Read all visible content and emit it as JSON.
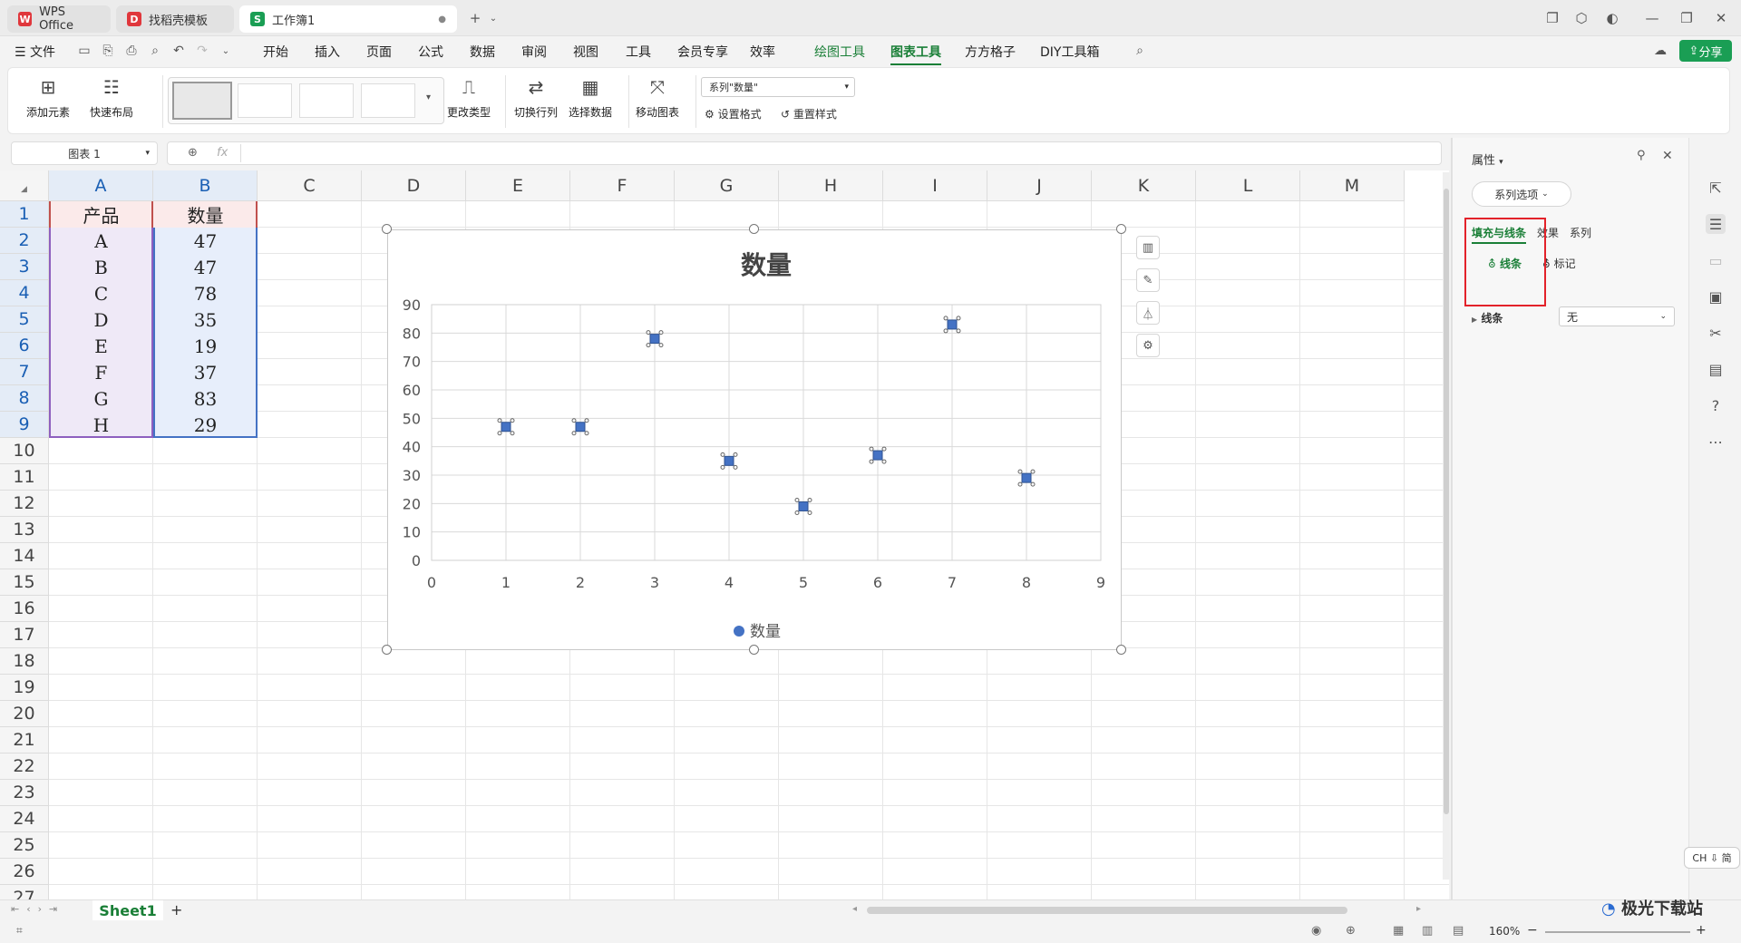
{
  "tabs": [
    {
      "label": "WPS Office",
      "icon": "wps-logo-icon"
    },
    {
      "label": "找稻壳模板",
      "icon": "docer-icon"
    },
    {
      "label": "工作簿1",
      "icon": "spreadsheet-icon"
    }
  ],
  "menu": {
    "file": "文件",
    "items": [
      "开始",
      "插入",
      "页面",
      "公式",
      "数据",
      "审阅",
      "视图",
      "工具",
      "会员专享",
      "效率",
      "绘图工具",
      "图表工具",
      "方方格子",
      "DIY工具箱"
    ],
    "active": "图表工具",
    "share": "分享"
  },
  "ribbon": {
    "add_element": "添加元素",
    "quick_layout": "快速布局",
    "change_type": "更改类型",
    "switch_rowcol": "切换行列",
    "select_data": "选择数据",
    "move_chart": "移动图表",
    "series_select": "系列\"数量\"",
    "set_format": "设置格式",
    "reset_style": "重置样式"
  },
  "formula": {
    "name_box": "图表 1",
    "fx": "fx"
  },
  "sheet": {
    "columns": [
      "A",
      "B",
      "C",
      "D",
      "E",
      "F",
      "G",
      "H",
      "I",
      "J",
      "K",
      "L",
      "M"
    ],
    "rows": [
      "1",
      "2",
      "3",
      "4",
      "5",
      "6",
      "7",
      "8",
      "9",
      "10",
      "11",
      "12",
      "13",
      "14",
      "15",
      "16",
      "17",
      "18",
      "19",
      "20",
      "21",
      "22",
      "23",
      "24",
      "25",
      "26",
      "27"
    ],
    "headers": [
      "产品",
      "数量"
    ],
    "data": [
      [
        "A",
        "47"
      ],
      [
        "B",
        "47"
      ],
      [
        "C",
        "78"
      ],
      [
        "D",
        "35"
      ],
      [
        "E",
        "19"
      ],
      [
        "F",
        "37"
      ],
      [
        "G",
        "83"
      ],
      [
        "H",
        "29"
      ]
    ]
  },
  "chart_data": {
    "type": "scatter",
    "title": "数量",
    "series": [
      {
        "name": "数量",
        "x": [
          1,
          2,
          3,
          4,
          5,
          6,
          7,
          8
        ],
        "y": [
          47,
          47,
          78,
          35,
          19,
          37,
          83,
          29
        ],
        "color": "#4472c4"
      }
    ],
    "xlim": [
      0,
      9
    ],
    "ylim": [
      0,
      90
    ],
    "xticks": [
      "0",
      "1",
      "2",
      "3",
      "4",
      "5",
      "6",
      "7",
      "8",
      "9"
    ],
    "yticks": [
      "0",
      "10",
      "20",
      "30",
      "40",
      "50",
      "60",
      "70",
      "80",
      "90"
    ],
    "grid": true,
    "legend": "bottom"
  },
  "pane": {
    "title": "属性",
    "dropdown": "系列选项",
    "tabs": [
      "填充与线条",
      "效果",
      "系列"
    ],
    "sub_line": "线条",
    "sub_marker": "标记",
    "line_label": "线条",
    "line_value": "无"
  },
  "sheet_tabs": {
    "name": "Sheet1",
    "add": "+"
  },
  "status": {
    "zoom": "160%",
    "ime": "CH ⇩ 简"
  },
  "watermark": "极光下载站"
}
